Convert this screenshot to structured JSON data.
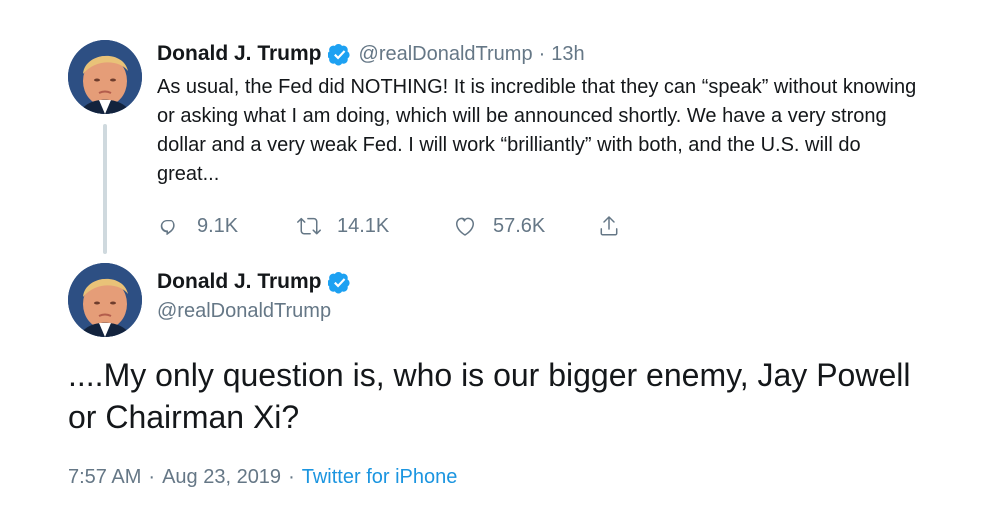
{
  "parent_tweet": {
    "display_name": "Donald J. Trump",
    "handle": "@realDonaldTrump",
    "separator": "·",
    "time": "13h",
    "text": "As usual, the Fed did NOTHING! It is incredible that they can “speak” without knowing or asking what I am doing, which will be announced shortly. We have a very strong dollar and a very weak Fed. I will work “brilliantly” with both, and the U.S. will do great...",
    "actions": {
      "replies": "9.1K",
      "retweets": "14.1K",
      "likes": "57.6K"
    }
  },
  "main_tweet": {
    "display_name": "Donald J. Trump",
    "handle": "@realDonaldTrump",
    "text": "....My only question is, who is our bigger enemy, Jay Powell or Chairman Xi?",
    "time": "7:57 AM",
    "date": "Aug 23, 2019",
    "separator": "·",
    "source": "Twitter for iPhone"
  },
  "icons": {
    "verified": "verified-badge-icon",
    "reply": "reply-icon",
    "retweet": "retweet-icon",
    "like": "like-icon",
    "share": "share-icon"
  },
  "colors": {
    "text": "#14171a",
    "muted": "#657786",
    "link": "#1b95e0",
    "verified": "#1da1f2",
    "thread_line": "#cfd9de"
  }
}
